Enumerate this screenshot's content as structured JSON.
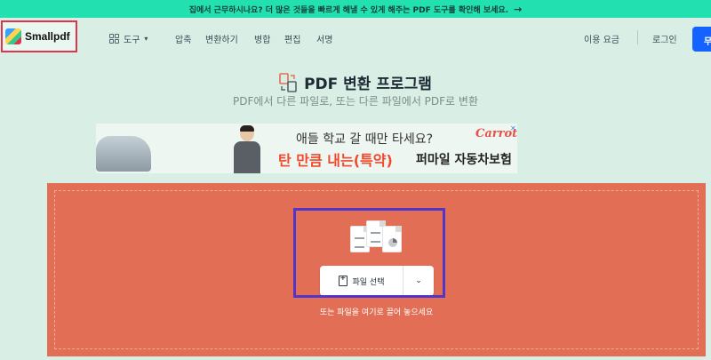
{
  "banner": {
    "text": "집에서 근무하시나요? 더 많은 것들을 빠르게 해낼 수 있게 해주는 PDF 도구를 확인해 보세요.",
    "arrow": "→"
  },
  "header": {
    "logo_text": "Smallpdf",
    "tools_label": "도구",
    "menu": [
      "압축",
      "변환하기",
      "병합",
      "편집",
      "서명"
    ],
    "pricing_label": "이용 요금",
    "login_label": "로그인",
    "cta_label": "무"
  },
  "main": {
    "title": "PDF 변환 프로그램",
    "subtitle": "PDF에서 다른 파일로, 또는 다른 파일에서 PDF로 변환"
  },
  "ad": {
    "line1": "애들 학교 갈 때만 타세요?",
    "line2": "탄 만큼 내는(특약)",
    "line2b": "퍼마일 자동차보험",
    "logo": "Carrot",
    "close": "✕"
  },
  "dropzone": {
    "select_label": "파일 선택",
    "dropdown_icon": "chevron-down-icon",
    "hint": "또는 파일을 여기로 끌어 놓으세요"
  },
  "colors": {
    "banner": "#22e0b0",
    "background": "#d9efe5",
    "dropzone": "#e26f55",
    "cta": "#1463ff",
    "logo_highlight": "#e0344d",
    "focus_highlight": "#5235c9"
  }
}
